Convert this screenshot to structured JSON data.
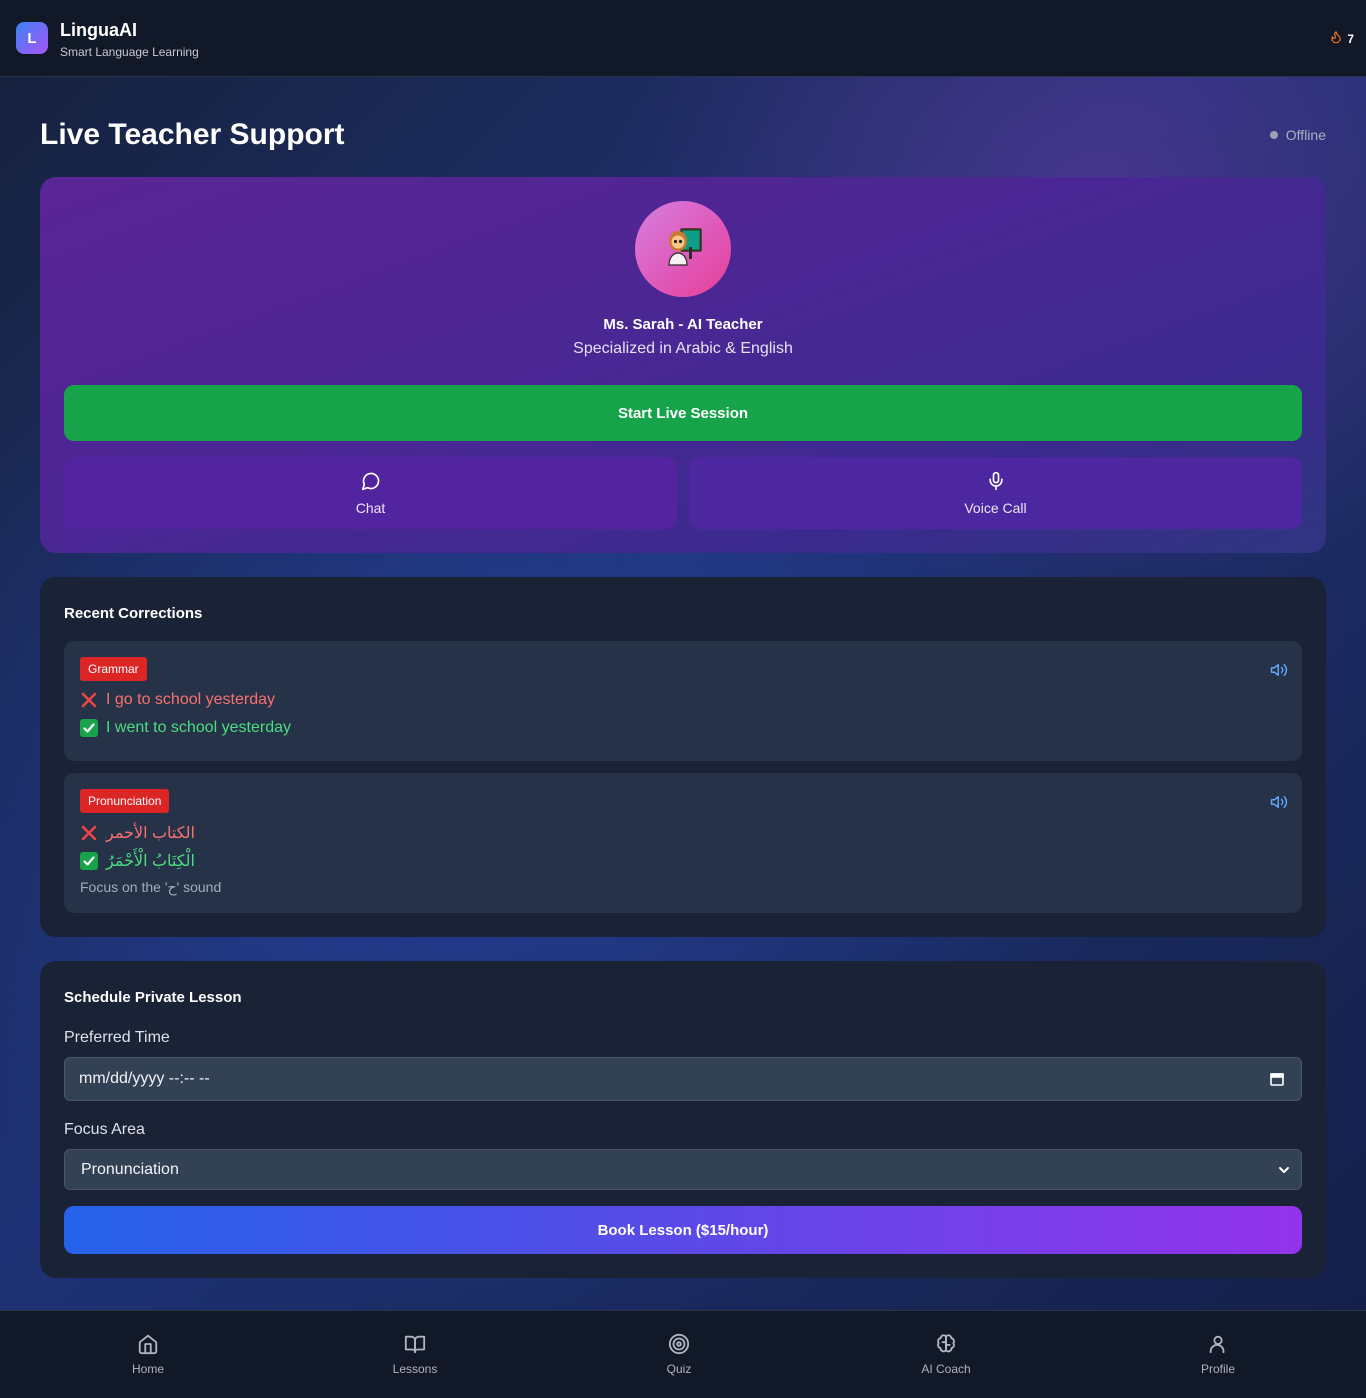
{
  "header": {
    "logo_letter": "L",
    "app_title": "LinguaAI",
    "app_subtitle": "Smart Language Learning",
    "streak_count": "7",
    "streak_icon": "flame-icon"
  },
  "page": {
    "title": "Live Teacher Support",
    "status": "Offline"
  },
  "teacher": {
    "avatar_icon": "teacher-icon",
    "name": "Ms. Sarah - AI Teacher",
    "specialization": "Specialized in Arabic & English",
    "start_label": "Start Live Session",
    "chat_label": "Chat",
    "voice_label": "Voice Call"
  },
  "corrections": {
    "title": "Recent Corrections",
    "items": [
      {
        "tag": "Grammar",
        "wrong": "I go to school yesterday",
        "right": "I went to school yesterday",
        "note": ""
      },
      {
        "tag": "Pronunciation",
        "wrong": "الكتاب الأحمر",
        "right": "الْكِتَابُ الْأَحْمَرُ",
        "note": "Focus on the 'ح' sound"
      }
    ]
  },
  "schedule": {
    "title": "Schedule Private Lesson",
    "time_label": "Preferred Time",
    "time_placeholder": "mm/dd/yyyy --:-- --",
    "focus_label": "Focus Area",
    "focus_value": "Pronunciation",
    "book_label": "Book Lesson ($15/hour)"
  },
  "nav": {
    "items": [
      {
        "label": "Home",
        "icon": "home-icon"
      },
      {
        "label": "Lessons",
        "icon": "book-icon"
      },
      {
        "label": "Quiz",
        "icon": "target-icon"
      },
      {
        "label": "AI Coach",
        "icon": "brain-icon"
      },
      {
        "label": "Profile",
        "icon": "user-icon"
      }
    ]
  },
  "colors": {
    "accent_green": "#16a34a",
    "tag_red": "#dc2626",
    "wrong_text": "#f87171",
    "right_text": "#4ade80",
    "card_bg": "#1a2236"
  }
}
